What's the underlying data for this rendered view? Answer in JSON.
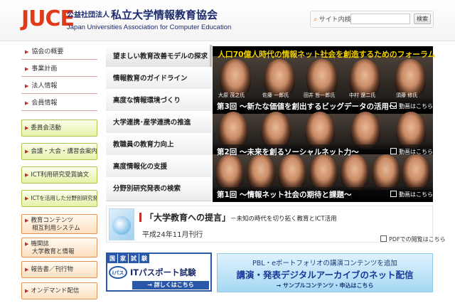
{
  "header": {
    "logo_mark": "JUCE",
    "logo_prefix": "公益社団法人",
    "logo_name": "私立大学情報教育協会",
    "logo_english": "Japan Universities Association for Computer Education",
    "search_label": "サイト内検索",
    "search_value": "",
    "search_button": "検索"
  },
  "left_nav": {
    "items": [
      {
        "label": "協会の概要"
      },
      {
        "label": "事業計画"
      },
      {
        "label": "法人情報"
      },
      {
        "label": "会員情報"
      }
    ],
    "green_boxes": [
      {
        "label": "委員会活動"
      },
      {
        "label": "会議・大会・講習会案内/報告"
      },
      {
        "label": "ICT利用研究受賞論文"
      },
      {
        "label": "ICTを活用した分野別研究発表"
      }
    ],
    "orange_boxes": [
      {
        "line1": "教育コンテンツ",
        "line2": "相互利用システム"
      },
      {
        "line1": "機関誌",
        "line2": "大学教育と情報"
      },
      {
        "line1": "報告書／刊行物",
        "line2": ""
      },
      {
        "line1": "オンデマンド配信",
        "line2": ""
      }
    ]
  },
  "middle_menu": {
    "items": [
      {
        "label": "望ましい教育改善モデルの探求"
      },
      {
        "label": "情報教育のガイドライン"
      },
      {
        "label": "高度な情報環境づくり"
      },
      {
        "label": "大学連携･産学連携の推進"
      },
      {
        "label": "教職員の教育力向上"
      },
      {
        "label": "高度情報化の支援"
      },
      {
        "label": "分野別研究発表の検索"
      }
    ]
  },
  "banner": {
    "title": "人口70億人時代の情報ネット社会を創造するためのフォーラム",
    "sessions": [
      {
        "title": "第3回 ～新たな価値を創出するビッグデータの活用～",
        "link": "動画はこちら",
        "names": [
          "大原 茂之氏",
          "佐藤 一郎氏",
          "田井 哲一郎氏",
          "中村 遼二氏",
          "須藤 修氏"
        ]
      },
      {
        "title": "第2回 ～未来を創るソーシャルネット力～",
        "link": "動画はこちら",
        "names": []
      },
      {
        "title": "第1回 ～情報ネット社会の期待と課題～",
        "link": "動画はこちら",
        "names": []
      }
    ]
  },
  "proposal": {
    "title": "「大学教育への提言」",
    "subtitle": "－未知の時代を切り拓く教育とICT活用",
    "date": "平成24年11月刊行",
    "pdf_link": "PDFでの閲覧はこちら"
  },
  "itpassport": {
    "head": [
      "国",
      "家",
      "試",
      "験"
    ],
    "logo": "iパス",
    "title": "ITパスポート試験",
    "link": "→ 詳しくはこちら"
  },
  "pbl": {
    "line1": "PBL・eポートフォリオの講演コンテンツを追加",
    "line2": "講演・発表デジタルアーカイブのネット配信",
    "line3": "→ サンプルコンテンツ・申込はこちら"
  }
}
